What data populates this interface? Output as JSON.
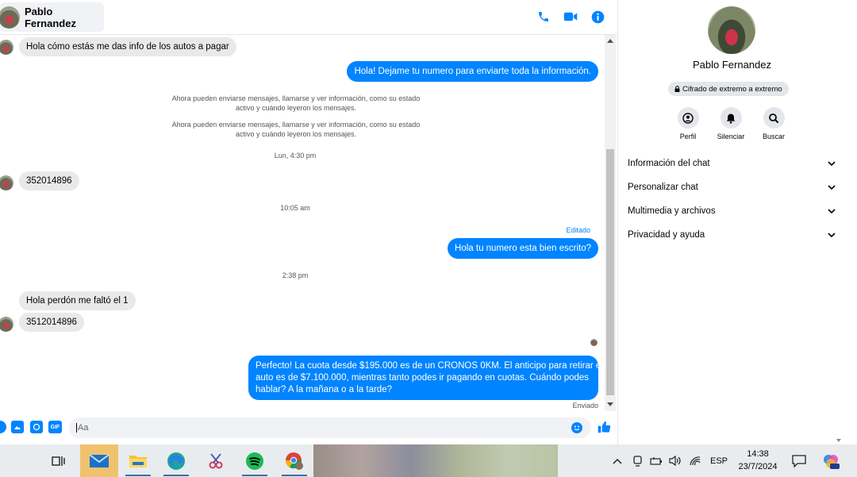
{
  "header": {
    "contact_name": "Pablo Fernandez",
    "icons": [
      "phone-icon",
      "video-icon",
      "info-icon"
    ]
  },
  "messages": {
    "m1": "Hola cómo estás me das info de los autos a pagar",
    "m2": "Hola! Dejame tu numero  para enviarte toda la información.",
    "sys1_line1": "Ahora pueden enviarse mensajes, llamarse y ver información, como su estado",
    "sys1_line2": "activo y cuándo leyeron los mensajes.",
    "sys2_line1": "Ahora pueden enviarse mensajes, llamarse y ver información, como su estado",
    "sys2_line2": "activo y cuándo leyeron los mensajes.",
    "time1": "Lun, 4:30 pm",
    "m3": "352014896",
    "time2": "10:05 am",
    "edited": "Editado",
    "m4": "Hola tu numero esta bien escrito?",
    "time3": "2:38 pm",
    "m5": "Hola perdón me faltó el 1",
    "m6": "3512014896",
    "m7_line1": "Perfecto! La cuota desde $195.000 es de un CRONOS 0KM. El anticipo para retirar el",
    "m7_line2": "auto es de $7.100.000, mientras tanto podes ir pagando en cuotas. Cuándo podes",
    "m7_line3": "hablar? A la mañana o a la tarde?",
    "status": "Enviado"
  },
  "composer": {
    "placeholder": "Aa",
    "gif_label": "GIF"
  },
  "info_panel": {
    "name": "Pablo Fernandez",
    "encryption": "Cifrado de extremo a extremo",
    "actions": [
      {
        "label": "Perfil",
        "icon": "profile-icon"
      },
      {
        "label": "Silenciar",
        "icon": "bell-icon"
      },
      {
        "label": "Buscar",
        "icon": "search-icon"
      }
    ],
    "sections": [
      "Información del chat",
      "Personalizar chat",
      "Multimedia y archivos",
      "Privacidad y ayuda"
    ]
  },
  "taskbar": {
    "language": "ESP",
    "time": "14:38",
    "date": "23/7/2024",
    "apps": [
      "task-view-icon",
      "mail-icon",
      "file-explorer-icon",
      "edge-icon",
      "snipping-tool-icon",
      "spotify-icon",
      "chrome-icon"
    ]
  },
  "colors": {
    "accent": "#0084ff",
    "incoming_bubble": "#e9e9eb"
  }
}
